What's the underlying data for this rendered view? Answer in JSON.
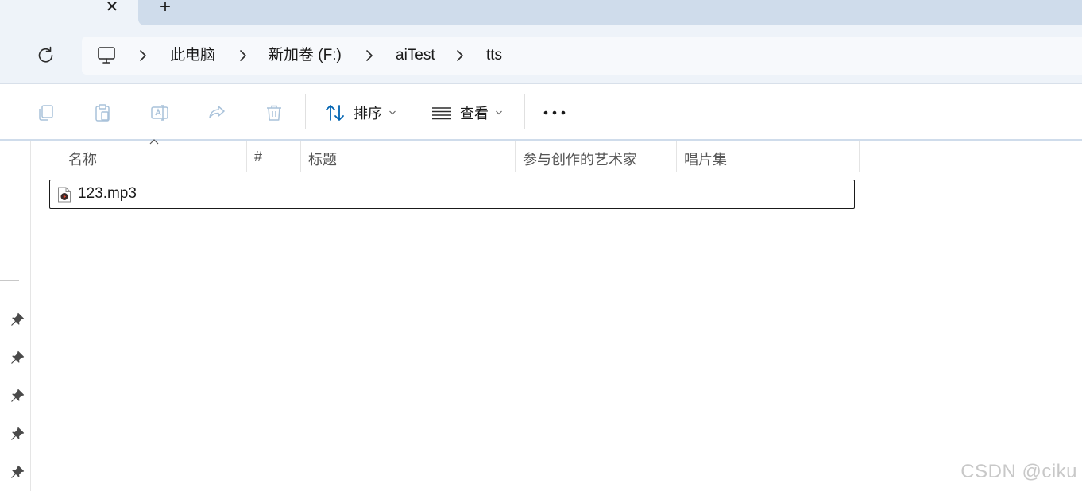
{
  "tabbar": {
    "close_glyph": "✕",
    "new_tab_glyph": "+"
  },
  "address": {
    "refresh_icon": "refresh-icon",
    "root_icon": "monitor-icon",
    "crumbs": [
      "此电脑",
      "新加卷 (F:)",
      "aiTest",
      "tts"
    ]
  },
  "toolbar": {
    "sort_label": "排序",
    "view_label": "查看",
    "more_glyph": "•••",
    "disabled_icons": [
      "copy-icon",
      "paste-icon",
      "rename-icon",
      "share-icon",
      "delete-icon"
    ]
  },
  "columns": [
    "名称",
    "#",
    "标题",
    "参与创作的艺术家",
    "唱片集"
  ],
  "files": [
    {
      "name": "123.mp3",
      "icon": "audio-file-icon"
    }
  ],
  "watermark": "CSDN @ciku",
  "colors": {
    "accent": "#0063b1",
    "disabled_icon": "#a9c2da",
    "selection_border": "#1a1a1a",
    "chrome_bg": "#eef3f9"
  }
}
